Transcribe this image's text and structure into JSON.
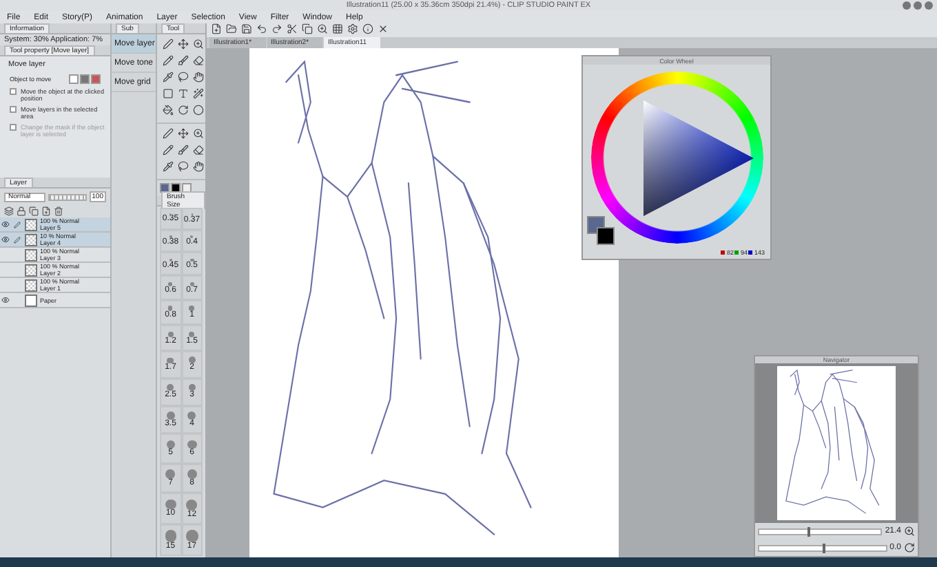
{
  "window": {
    "title": "Illustration11 (25.00 x 35.36cm 350dpi 21.4%) - CLIP STUDIO PAINT EX"
  },
  "menu": [
    "File",
    "Edit",
    "Story(P)",
    "Animation",
    "Layer",
    "Selection",
    "View",
    "Filter",
    "Window",
    "Help"
  ],
  "information": {
    "tab": "Information",
    "text": "System: 30%  Application: 7%"
  },
  "tool_property": {
    "tab": "Tool property [Move layer]",
    "heading": "Move layer",
    "object_label": "Object to move",
    "options": [
      {
        "label": "Move the object at the clicked position",
        "checked": false,
        "disabled": false
      },
      {
        "label": "Move layers in the selected area",
        "checked": false,
        "disabled": false
      },
      {
        "label": "Change the mask if the object layer is selected",
        "checked": false,
        "disabled": true
      }
    ]
  },
  "layer_panel": {
    "tab": "Layer",
    "blend_mode": "Normal",
    "opacity": "100",
    "opacity_slider": {
      "level": 1
    },
    "layers": [
      {
        "mode": "100 % Normal",
        "name": "Layer 5",
        "visible": true,
        "editing": true,
        "selected": true
      },
      {
        "mode": "10 % Normal",
        "name": "Layer 4",
        "visible": true,
        "editing": true,
        "selected": true
      },
      {
        "mode": "100 % Normal",
        "name": "Layer 3",
        "visible": false,
        "editing": false,
        "selected": false
      },
      {
        "mode": "100 % Normal",
        "name": "Layer 2",
        "visible": false,
        "editing": false,
        "selected": false
      },
      {
        "mode": "100 % Normal",
        "name": "Layer 1",
        "visible": false,
        "editing": false,
        "selected": false
      },
      {
        "name": "Paper",
        "visible": true,
        "editing": false,
        "selected": false
      }
    ]
  },
  "sub_tool": {
    "tab": "Sub",
    "items": [
      {
        "label": "Move layer",
        "selected": true
      },
      {
        "label": "Move tone",
        "selected": false
      },
      {
        "label": "Move grid",
        "selected": false
      }
    ]
  },
  "tool": {
    "tab": "Tool"
  },
  "brush_size": {
    "tab": "Brush Size",
    "sizes": [
      "0.35",
      "0.37",
      "0.38",
      "0.4",
      "0.45",
      "0.5",
      "0.6",
      "0.7",
      "0.8",
      "1",
      "1.2",
      "1.5",
      "1.7",
      "2",
      "2.5",
      "3",
      "3.5",
      "4",
      "5",
      "6",
      "7",
      "8",
      "10",
      "12",
      "15",
      "17"
    ]
  },
  "doc_tabs": [
    {
      "label": "Illustration1*",
      "selected": false
    },
    {
      "label": "Illustration2*",
      "selected": false
    },
    {
      "label": "Illustration11",
      "selected": true
    }
  ],
  "color_wheel": {
    "title": "Color Wheel",
    "r": "82",
    "g": "94",
    "b": "143"
  },
  "navigator": {
    "title": "Navigator",
    "zoom": "21.4",
    "zoom_slider": {
      "level": 0.4
    },
    "angle": "0.0",
    "rotation_slider": {
      "level": 0.5
    }
  }
}
